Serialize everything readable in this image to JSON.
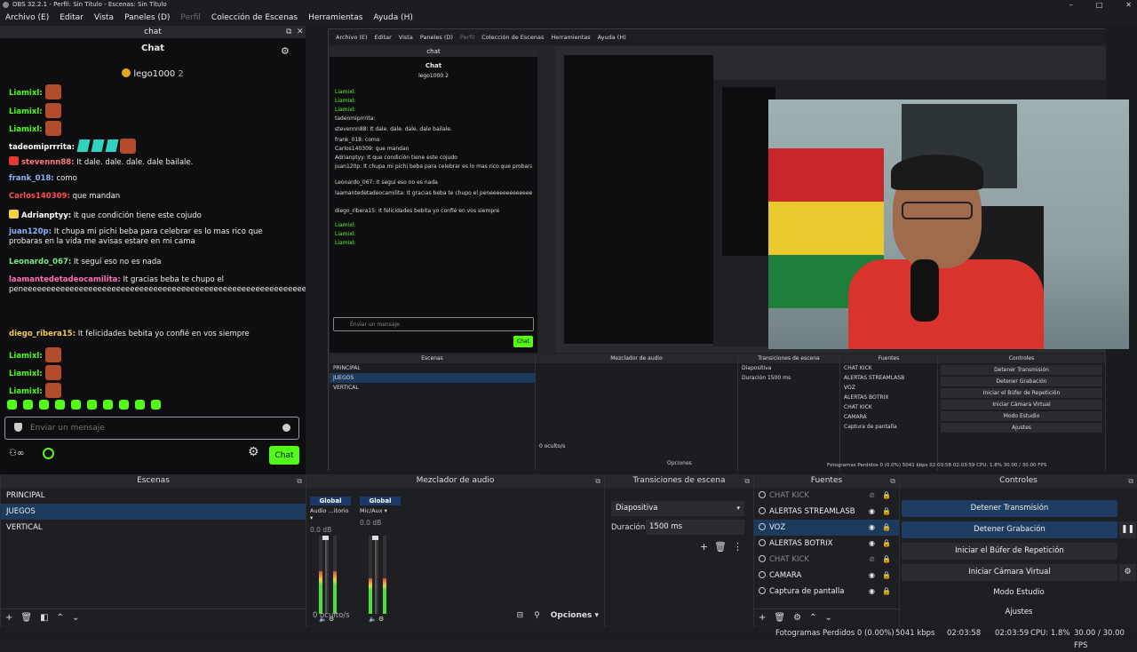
{
  "window": {
    "title": "OBS 32.2.1 - Perfil: Sin Título - Escenas: Sin Título"
  },
  "menu": {
    "items": [
      {
        "label": "Archivo (E)"
      },
      {
        "label": "Editar"
      },
      {
        "label": "Vista"
      },
      {
        "label": "Paneles (D)"
      },
      {
        "label": "Perfil",
        "disabled": true
      },
      {
        "label": "Colección de Escenas"
      },
      {
        "label": "Herramientas"
      },
      {
        "label": "Ayuda (H)"
      }
    ]
  },
  "chat": {
    "dock_title": "chat",
    "title": "Chat",
    "pinned_user": "lego1000",
    "pinned_count": "2",
    "messages": [
      {
        "user": "Liamixl:",
        "color": "#53fc18",
        "text": "",
        "emote": true
      },
      {
        "user": "Liamixl:",
        "color": "#53fc18",
        "text": "",
        "emote": true
      },
      {
        "user": "Liamixl:",
        "color": "#53fc18",
        "text": "",
        "emote": true
      },
      {
        "user": "tadeomiprrrita:",
        "color": "#ffffff",
        "text": "",
        "gems": true
      },
      {
        "user": "stevennn88:",
        "color": "#ff7b7b",
        "text": "It dale. dale. dale. dale bailale.",
        "badge": "#e53935"
      },
      {
        "user": "frank_018:",
        "color": "#8ab4f8",
        "text": "como"
      },
      {
        "user": "Carlos140309:",
        "color": "#ff4f4f",
        "text": "que mandan"
      },
      {
        "user": "Adrianptyy:",
        "color": "#ffffff",
        "text": "It que condición tiene este cojudo",
        "badge": "#f5d442"
      },
      {
        "user": "juan120p:",
        "color": "#8ab4f8",
        "text": "It chupa mi pichi beba para celebrar es lo mas rico que probaras en la vida me avisas estare en mi cama"
      },
      {
        "user": "Leonardo_067:",
        "color": "#7ee787",
        "text": "It seguí eso no es nada"
      },
      {
        "user": "laamantedetadeocamilita:",
        "color": "#ff6fb5",
        "text": "It gracias beba te chupo el peneeeeeeeeeeeeeeeeeeeeeeeeeeeeeeeeeeeeeeeeeeeeeeeeeeeeeeeeeeeeeeeeeeeeeeeeeeeeeeeeeeeeeeeeeeeeeeeeeeee"
      },
      {
        "user": "diego_ribera15:",
        "color": "#f7c95a",
        "text": "It felicidades bebita yo confié en vos siempre"
      },
      {
        "user": "Liamixl:",
        "color": "#53fc18",
        "text": "",
        "emote": true
      },
      {
        "user": "Liamixl:",
        "color": "#53fc18",
        "text": "",
        "emote": true
      },
      {
        "user": "Liamixl:",
        "color": "#53fc18",
        "text": "",
        "emote": true
      }
    ],
    "input_placeholder": "Enviar un mensaje",
    "send_label": "Chat"
  },
  "nested": {
    "menu": [
      "Archivo (E)",
      "Editar",
      "Vista",
      "Paneles (D)",
      "Perfil",
      "Colección de Escenas",
      "Herramientas",
      "Ayuda (H)"
    ],
    "chat_dock": "chat",
    "chat_title": "Chat",
    "pinned": "lego1000 2",
    "input": "Enviar un mensaje",
    "send": "Chat",
    "msgs": [
      "Liamixl:",
      "Liamixl:",
      "Liamixl:",
      "tadeomiprrrita:",
      "stevennn88: It dale. dale. dale. dale bailale.",
      "frank_018: como",
      "Carlos140309: que mandan",
      "Adrianptyy: It que condición tiene este cojudo",
      "juan120p: It chupa mi pichi beba para celebrar es lo mas rico que probaras en la vida me avisas estare en mi cama",
      "Leonardo_067: It seguí eso no es nada",
      "laamantedetadeocamilita: It gracias beba te chupo el peneeeeeeeeeeeeeeeeeeeeeeeeeeeeeeeeeeeeeeeeeeeeeeeeeeeeeeeeeeeeeeeeeeeeeeeeeeeee",
      "diego_ribera15: It felicidades bebita yo confié en vos siempre",
      "Liamixl:",
      "Liamixl:",
      "Liamixl:"
    ],
    "docks": {
      "scenes": "Escenas",
      "mixer": "Mezclador de audio",
      "trans": "Transiciones de escena",
      "sources": "Fuentes",
      "controls": "Controles"
    },
    "scenes": [
      "PRINCIPAL",
      "JUEGOS",
      "VERTICAL"
    ],
    "sources": [
      "CHAT KICK",
      "ALERTAS STREAMLASB",
      "VOZ",
      "ALERTAS BOTRIX",
      "CHAT KICK",
      "CAMARA",
      "Captura de pantalla"
    ],
    "controls": [
      "Detener Transmisión",
      "Detener Grabación",
      "Iniciar el Búfer de Repetición",
      "Iniciar Cámara Virtual",
      "Modo Estudio",
      "Ajustes"
    ],
    "trans": "Diapositiva",
    "dur_label": "Duración",
    "dur": "1500 ms",
    "hidden": "0 oculto/s",
    "options": "Opciones",
    "status": "Fotogramas Perdidos 0 (0.0%)   5041 kbps   02:03:58   02:03:59   CPU: 1.8%   30.00 / 30.00 FPS"
  },
  "scenes": {
    "title": "Escenas",
    "items": [
      {
        "label": "PRINCIPAL"
      },
      {
        "label": "JUEGOS",
        "selected": true
      },
      {
        "label": "VERTICAL"
      }
    ]
  },
  "mixer": {
    "title": "Mezclador de audio",
    "channels": [
      {
        "name": "Global",
        "device": "Audio ...itorio",
        "db": "0.0 dB",
        "level": 0.55
      },
      {
        "name": "Global",
        "device": "Mic/Aux",
        "db": "0.0 dB",
        "level": 0.45
      }
    ],
    "hidden": "0 oculto/s",
    "options": "Opciones"
  },
  "transitions": {
    "title": "Transiciones de escena",
    "selected": "Diapositiva",
    "duration_label": "Duración",
    "duration": "1500 ms"
  },
  "sources": {
    "title": "Fuentes",
    "items": [
      {
        "label": "CHAT KICK",
        "dim": true
      },
      {
        "label": "ALERTAS STREAMLASB"
      },
      {
        "label": "VOZ",
        "selected": true
      },
      {
        "label": "ALERTAS BOTRIX"
      },
      {
        "label": "CHAT KICK",
        "dim": true
      },
      {
        "label": "CAMARA"
      },
      {
        "label": "Captura de pantalla"
      }
    ]
  },
  "controls": {
    "title": "Controles",
    "buttons": [
      {
        "label": "Detener Transmisión",
        "active": true
      },
      {
        "label": "Detener Grabación",
        "active": true
      },
      {
        "label": "Iniciar el Búfer de Repetición"
      },
      {
        "label": "Iniciar Cámara Virtual"
      },
      {
        "label": "Modo Estudio"
      },
      {
        "label": "Ajustes"
      }
    ]
  },
  "status": {
    "dropped": "Fotogramas Perdidos 0 (0.00%)",
    "kbps": "5041 kbps",
    "stream_time": "02:03:58",
    "rec_time": "02:03:59",
    "cpu": "CPU: 1.8%",
    "fps": "30.00 / 30.00 FPS"
  }
}
